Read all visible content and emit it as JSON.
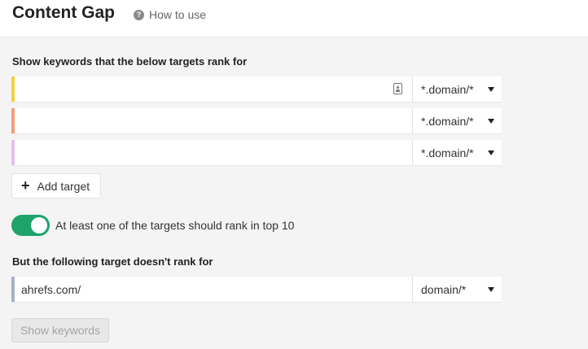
{
  "header": {
    "title": "Content Gap",
    "how_to_use": "How to use",
    "help_icon": "question-circle-icon"
  },
  "targets_section": {
    "title": "Show keywords that the below targets rank for",
    "rows": [
      {
        "value": "",
        "mode": "*.domain/*",
        "color": "#f5d23c"
      },
      {
        "value": "",
        "mode": "*.domain/*",
        "color": "#f49e7a"
      },
      {
        "value": "",
        "mode": "*.domain/*",
        "color": "#e3c1ec"
      }
    ],
    "add_target_label": "Add target"
  },
  "toggle": {
    "on": true,
    "label": "At least one of the targets should rank in top 10",
    "color": "#1ea36b"
  },
  "exclude_section": {
    "title": "But the following target doesn't rank for",
    "value": "ahrefs.com/",
    "mode": "domain/*",
    "color": "#a7b1c3"
  },
  "submit": {
    "label": "Show keywords",
    "disabled": true
  }
}
